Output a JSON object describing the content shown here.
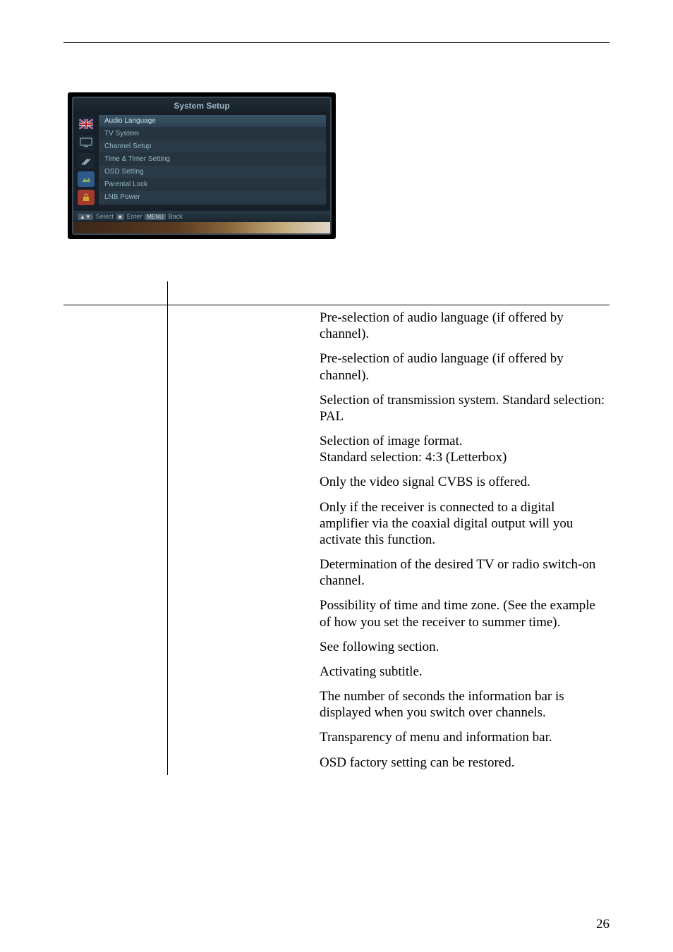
{
  "screenshot": {
    "title": "System Setup",
    "menu_items": [
      "Audio Language",
      "TV System",
      "Channel Setup",
      "Time & Timer Setting",
      "OSD Setting",
      "Parental Lock",
      "LNB Power"
    ],
    "hints": {
      "k1": "▲▼",
      "l1": "Select",
      "k2": "■",
      "l2": "Enter",
      "k3": "MENU",
      "l3": "Back"
    }
  },
  "rows": [
    "Pre-selection of audio language (if offered by channel).",
    "Pre-selection of audio language (if offered by channel).",
    "Selection of transmission system. Standard selection: PAL",
    "Selection of image format.\nStandard selection: 4:3 (Letterbox)",
    "Only the video signal CVBS is offered.",
    "Only if the receiver is connected to a digital amplifier via the coaxial digital output will you activate this function.",
    "Determination of the desired TV or radio switch-on channel.",
    "Possibility of time and time zone. (See the example of how you set the receiver to summer time).",
    "See following section.",
    "Activating subtitle.",
    "The number of seconds the information bar is displayed when you switch over channels.",
    "Transparency of menu and information bar.",
    "OSD factory setting can be restored."
  ],
  "page_number": "26"
}
